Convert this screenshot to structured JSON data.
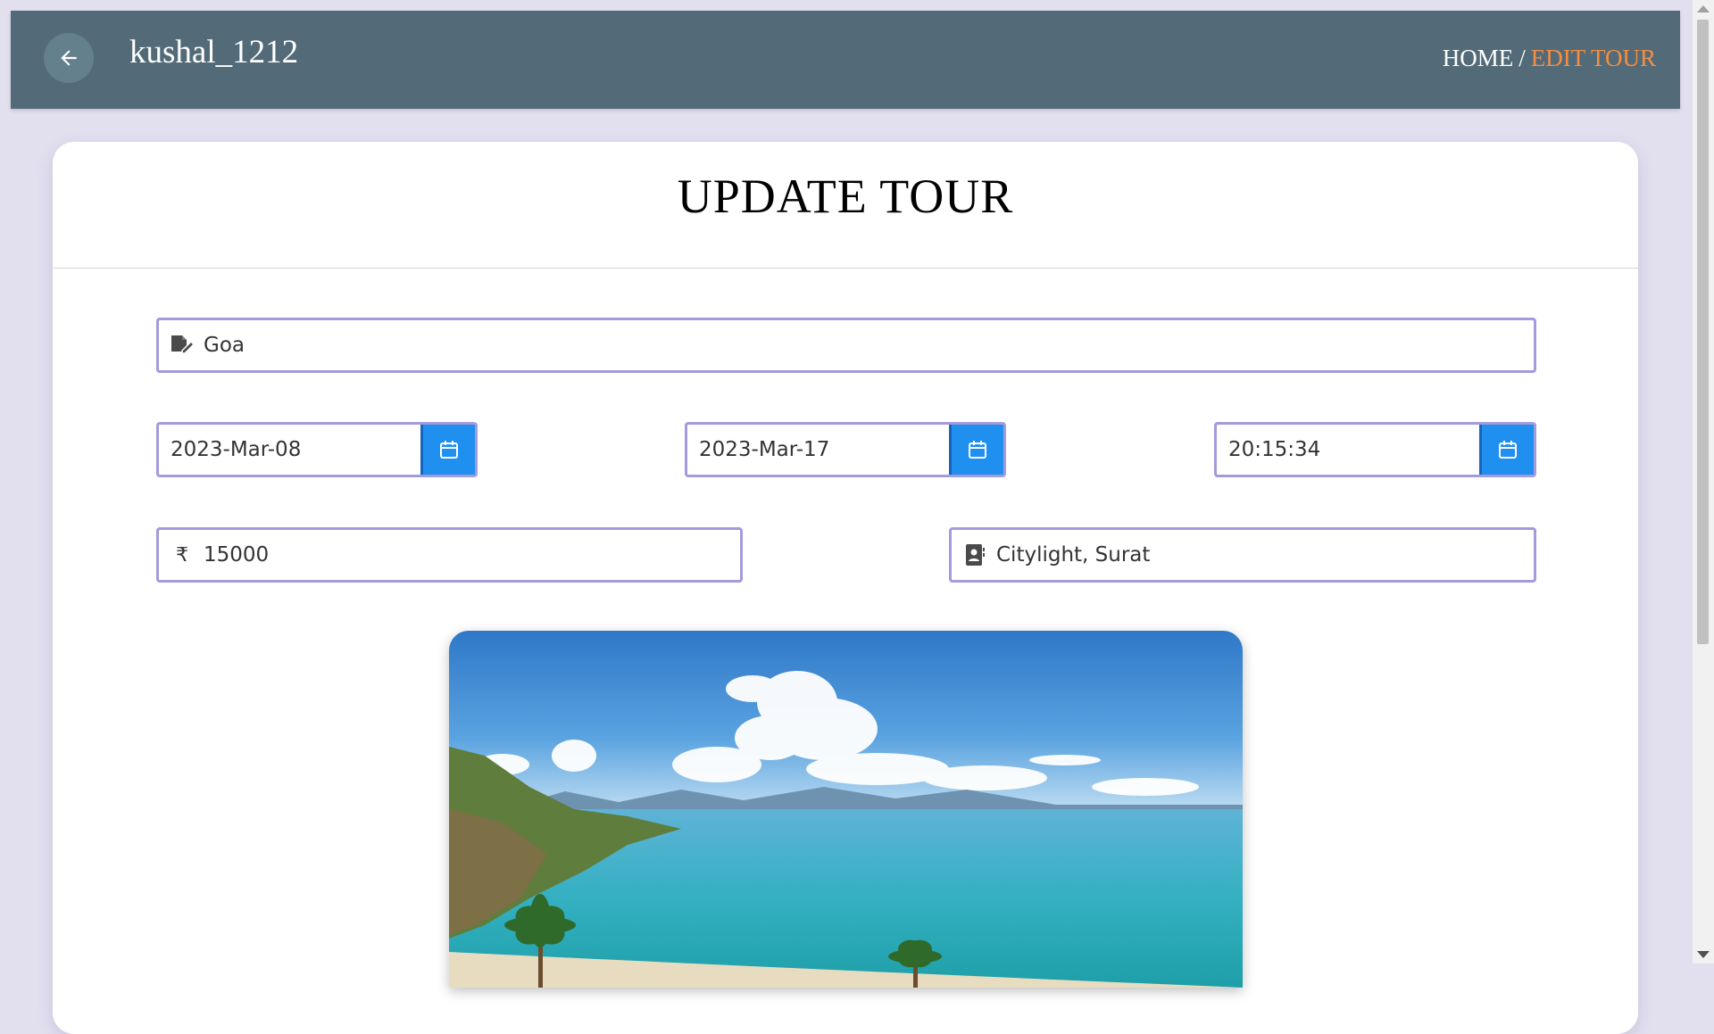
{
  "header": {
    "username": "kushal_1212",
    "breadcrumb": {
      "home": "HOME",
      "separator": "/",
      "current": "EDIT TOUR"
    }
  },
  "form": {
    "title": "UPDATE TOUR",
    "destination": {
      "value": "Goa",
      "icon": "edit-document-icon"
    },
    "start_date": {
      "value": "2023-Mar-08",
      "icon": "calendar-icon"
    },
    "end_date": {
      "value": "2023-Mar-17",
      "icon": "calendar-icon"
    },
    "time": {
      "value": "20:15:34",
      "icon": "calendar-icon"
    },
    "price": {
      "value": "15000",
      "icon": "rupee-icon"
    },
    "pickup": {
      "value": "Citylight, Surat",
      "icon": "contact-book-icon"
    },
    "image": {
      "subject": "tropical beach with palm trees and sea"
    }
  },
  "colors": {
    "header": "#536b78",
    "accent": "#f58d42",
    "button": "#1f8ff0",
    "field_border": "#a29bdc",
    "page_bg": "#e2e0ef"
  }
}
